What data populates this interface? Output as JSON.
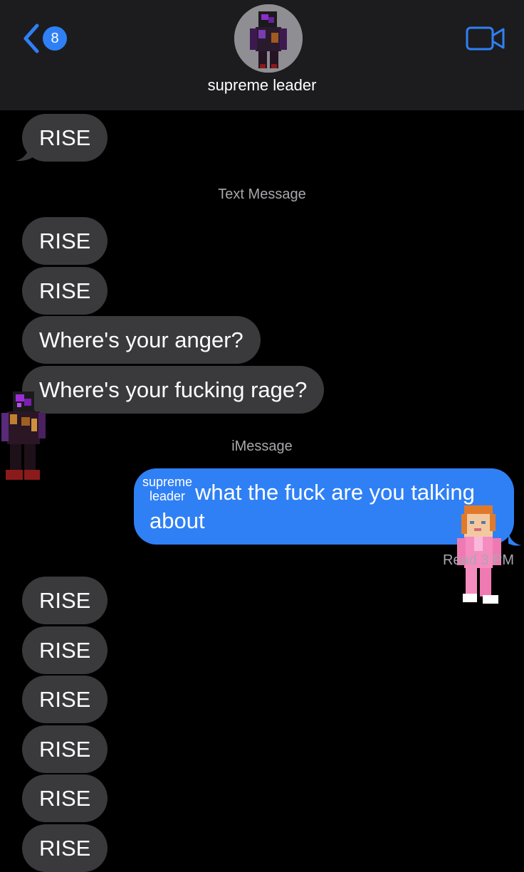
{
  "header": {
    "back_badge": "8",
    "contact_name": "supreme leader"
  },
  "messages": {
    "first": "RISE",
    "label_sms": "Text Message",
    "group1": [
      "RISE",
      "RISE",
      "Where's your anger?",
      "Where's your fucking rage?"
    ],
    "label_imessage": "iMessage",
    "sticker_label": "supreme leader",
    "sticker_line1": "supreme",
    "sticker_line2": "leader",
    "sent": "what the fuck are you talking about",
    "read_receipt": "Read 3   PM",
    "group2": [
      "RISE",
      "RISE",
      "RISE",
      "RISE",
      "RISE",
      "RISE"
    ]
  },
  "colors": {
    "background": "#000000",
    "header": "#1c1c1e",
    "incoming_bubble": "#3a3a3c",
    "outgoing_bubble": "#2f80f5",
    "accent": "#2f80f5",
    "label_gray": "#a8a8ad"
  },
  "icons": [
    "chevron-left-icon",
    "video-camera-icon",
    "contact-avatar",
    "purple-minecraft-character-sticker",
    "pink-minecraft-character-sticker"
  ]
}
